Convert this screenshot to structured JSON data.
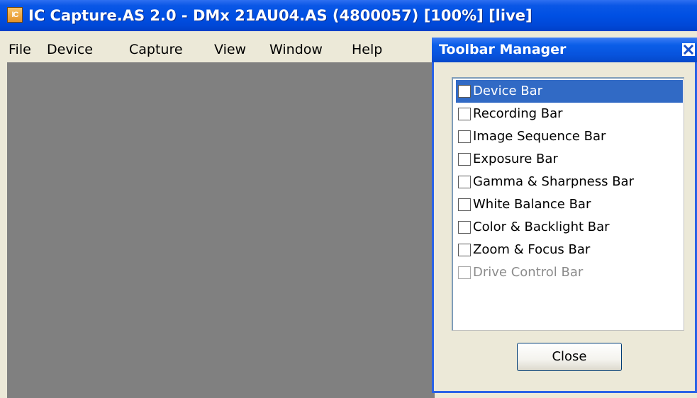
{
  "app": {
    "icon_text": "IC",
    "title": "IC Capture.AS 2.0 - DMx 21AU04.AS (4800057) [100%]  [live]"
  },
  "menubar": {
    "items": [
      {
        "label": "File"
      },
      {
        "label": "Device"
      },
      {
        "label": "Capture"
      },
      {
        "label": "View"
      },
      {
        "label": "Window"
      },
      {
        "label": "Help"
      }
    ]
  },
  "toolbar_manager": {
    "title": "Toolbar Manager",
    "items": [
      {
        "label": "Device Bar",
        "checked": false,
        "selected": true,
        "enabled": true
      },
      {
        "label": "Recording Bar",
        "checked": false,
        "selected": false,
        "enabled": true
      },
      {
        "label": "Image Sequence Bar",
        "checked": false,
        "selected": false,
        "enabled": true
      },
      {
        "label": "Exposure Bar",
        "checked": false,
        "selected": false,
        "enabled": true
      },
      {
        "label": "Gamma & Sharpness Bar",
        "checked": false,
        "selected": false,
        "enabled": true
      },
      {
        "label": "White Balance Bar",
        "checked": false,
        "selected": false,
        "enabled": true
      },
      {
        "label": "Color & Backlight Bar",
        "checked": false,
        "selected": false,
        "enabled": true
      },
      {
        "label": "Zoom & Focus Bar",
        "checked": false,
        "selected": false,
        "enabled": true
      },
      {
        "label": "Drive Control Bar",
        "checked": false,
        "selected": false,
        "enabled": false
      }
    ],
    "close_label": "Close"
  },
  "colors": {
    "titlebar": "#0050e3",
    "workspace": "#808080",
    "selection": "#316ac5",
    "dialog_bg": "#ece9d8"
  }
}
